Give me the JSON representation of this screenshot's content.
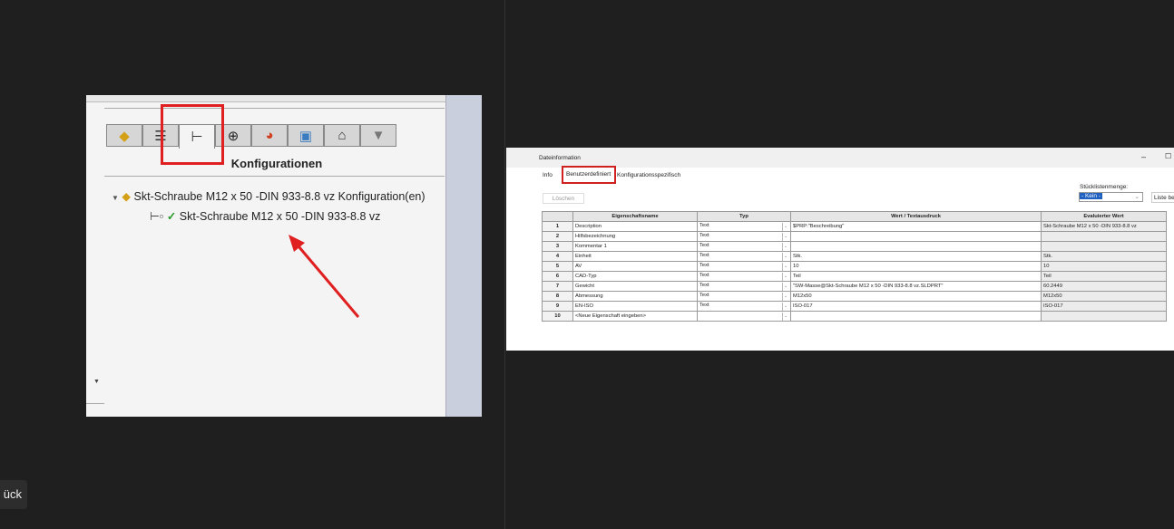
{
  "left_panel": {
    "tabs": [
      "part-icon",
      "property-manager-icon",
      "configuration-manager-icon",
      "dimxpert-icon",
      "appearance-icon",
      "display-manager-icon",
      "cam-icon",
      "tool-icon"
    ],
    "title": "Konfigurationen",
    "tree_root": "Skt-Schraube M12 x 50 -DIN 933-8.8 vz Konfiguration(en)",
    "tree_child": "Skt-Schraube M12 x 50 -DIN 933-8.8 vz"
  },
  "dialog": {
    "title": "Dateinformation",
    "tabs": [
      "Info",
      "Benutzerdefiniert",
      "Konfigurationsspezifisch"
    ],
    "delete_label": "Löschen",
    "bom_qty_label": "Stücklistenmenge:",
    "bom_qty_value": "- Kein -",
    "list_button": "Liste be",
    "columns": [
      "",
      "Eigenschaftsname",
      "Typ",
      "Wert / Textausdruck",
      "Evaluierter Wert"
    ],
    "rows": [
      {
        "n": "1",
        "name": "Description",
        "typ": "Text",
        "wert": "$PRP:\"Beschreibung\"",
        "eval": "Skt-Schraube M12 x 50 -DIN 933-8.8 vz"
      },
      {
        "n": "2",
        "name": "Hilfsbezeichnung",
        "typ": "Text",
        "wert": "",
        "eval": ""
      },
      {
        "n": "3",
        "name": "Kommentar 1",
        "typ": "Text",
        "wert": "",
        "eval": ""
      },
      {
        "n": "4",
        "name": "Einheit",
        "typ": "Text",
        "wert": "Stk.",
        "eval": "Stk."
      },
      {
        "n": "5",
        "name": "AV",
        "typ": "Text",
        "wert": "10",
        "eval": "10"
      },
      {
        "n": "6",
        "name": "CAD-Typ",
        "typ": "Text",
        "wert": "Teil",
        "eval": "Teil"
      },
      {
        "n": "7",
        "name": "Gewicht",
        "typ": "Text",
        "wert": "\"SW-Masse@Skt-Schraube M12 x 50 -DIN 933-8.8 vz.SLDPRT\"",
        "eval": "60.2449"
      },
      {
        "n": "8",
        "name": "Abmessung",
        "typ": "Text",
        "wert": "M12x50",
        "eval": "M12x50"
      },
      {
        "n": "9",
        "name": "EN-ISO",
        "typ": "Text",
        "wert": "ISO-017",
        "eval": "ISO-017"
      },
      {
        "n": "10",
        "name": "<Neue Eigenschaft eingeben>",
        "typ": "",
        "wert": "",
        "eval": ""
      }
    ]
  },
  "back_button": "ück",
  "annotation_color": "#e02020"
}
